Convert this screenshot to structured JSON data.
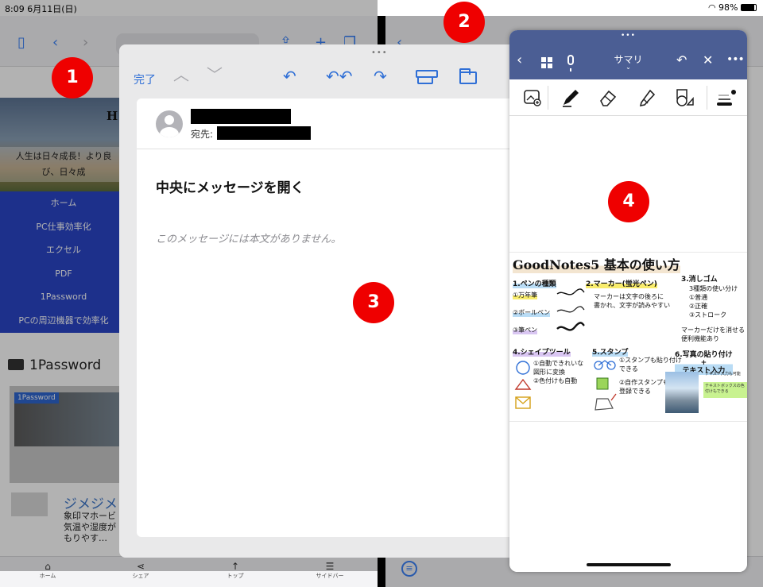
{
  "status_bar": {
    "time_date": "8:09  6月11日(日)",
    "battery": "98%"
  },
  "safari": {
    "hero": {
      "title_partial": "H",
      "tagline": "人生は日々成長！より良\nび、日々成"
    },
    "nav_items": [
      "ホーム",
      "PC仕事効率化",
      "エクセル",
      "PDF",
      "1Password",
      "PCの周辺機器で効率化"
    ],
    "category_heading": "1Password",
    "card1": {
      "badge": "1Password"
    },
    "card2": {
      "title": "ジメジメ",
      "text": "象印マホービ\n気温や湿度が\nもりやす…"
    },
    "tab_bar": [
      {
        "icon": "home-icon",
        "glyph": "⌂",
        "label": "ホーム"
      },
      {
        "icon": "share-icon",
        "glyph": "⋖",
        "label": "シェア"
      },
      {
        "icon": "arrow-up-icon",
        "glyph": "↑",
        "label": "トップ"
      },
      {
        "icon": "sidebar-list-icon",
        "glyph": "☰",
        "label": "サイドバー"
      }
    ]
  },
  "mail_window": {
    "done_label": "完了",
    "to_label": "宛先:",
    "subject": "中央にメッセージを開く",
    "body_placeholder": "このメッセージには本文がありません。"
  },
  "goodnotes": {
    "nav_title": "サマリ",
    "slide": {
      "title": "GoodNotes5  基本の使い方",
      "sec1_head": "1.ペンの種類",
      "sec1_items": [
        "①万年筆",
        "②ボールペン",
        "③筆ペン"
      ],
      "sec2_head": "2.マーカー(蛍光ペン)",
      "sec2_text": "マーカーは文字の後ろに\n書かれ、文字が読みやすい",
      "sec3_head": "3.消しゴム",
      "sec3_text": "3種類の使い分け\n①普通\n②正確\n③ストローク",
      "sec3_note": "マーカーだけを消せる\n便利機能あり",
      "sec4_head": "4.シェイプツール",
      "sec4_text": "①自動できれいな\n図形に変換\n②色付けも自動",
      "sec5_head": "5.スタンプ",
      "sec5_text": "①スタンプも貼り付け\nできる",
      "sec5_text2": "②自作スタンプも\n登録できる",
      "sec6_head": "6.写真の貼り付け\n+\nテキスト入力",
      "sec6_small": "テキスト入力も可能",
      "sec6_note": "テキストボックスの色付けもできる"
    }
  },
  "callouts": [
    "1",
    "2",
    "3",
    "4"
  ],
  "colors": {
    "callout_red": "#ef0000",
    "goodnotes_nav": "#4b5e94",
    "mail_blue": "#2f6fd6",
    "safari_nav_blue": "#2a46c8"
  }
}
